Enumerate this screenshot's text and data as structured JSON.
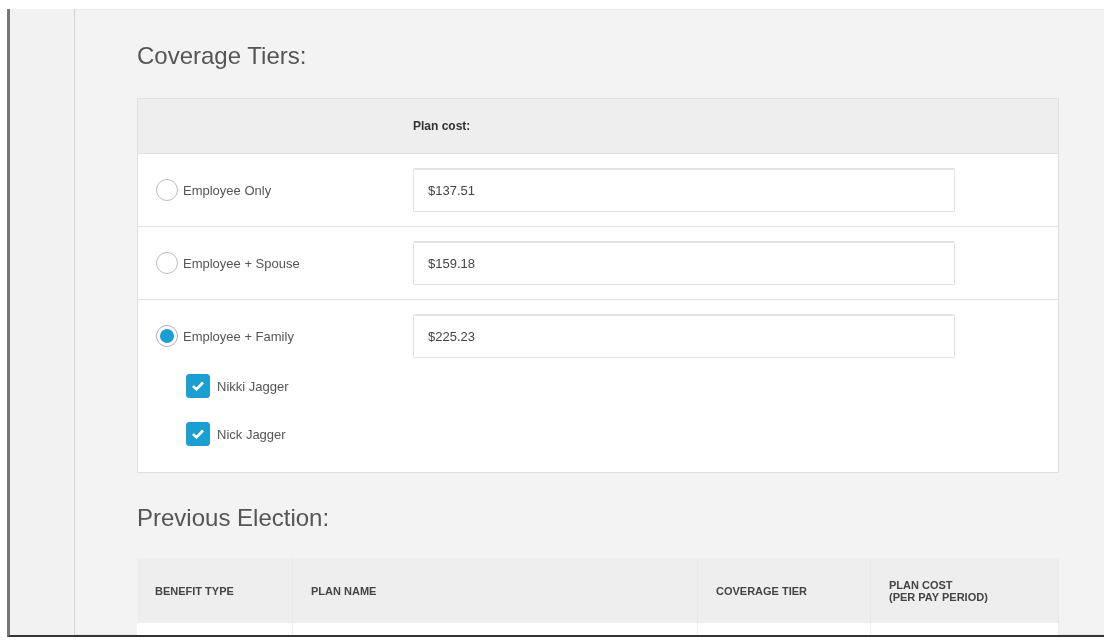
{
  "coverage": {
    "title": "Coverage Tiers:",
    "cost_header": "Plan cost:",
    "tiers": [
      {
        "label": "Employee Only",
        "cost": "$137.51",
        "selected": false
      },
      {
        "label": "Employee + Spouse",
        "cost": "$159.18",
        "selected": false
      },
      {
        "label": "Employee + Family",
        "cost": "$225.23",
        "selected": true,
        "dependents": [
          {
            "name": "Nikki Jagger",
            "checked": true
          },
          {
            "name": "Nick Jagger",
            "checked": true
          }
        ]
      }
    ]
  },
  "previous": {
    "title": "Previous Election:",
    "columns": [
      "BENEFIT TYPE",
      "PLAN NAME",
      "COVERAGE TIER",
      "PLAN COST\n(PER PAY PERIOD)"
    ]
  }
}
